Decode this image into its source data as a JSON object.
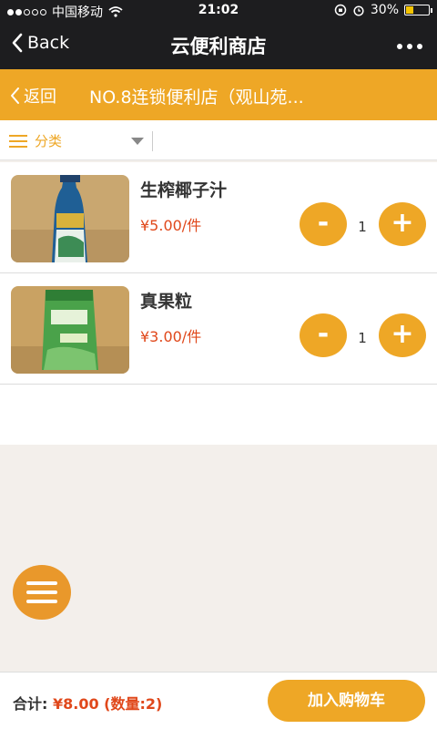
{
  "status_bar": {
    "carrier": "中国移动",
    "time": "21:02",
    "battery": "30%"
  },
  "nav": {
    "back_label": "Back",
    "title": "云便利商店"
  },
  "sub_header": {
    "back_label": "返回",
    "store_name": "NO.8连锁便利店（观山苑..."
  },
  "filter": {
    "category_label": "分类"
  },
  "products": [
    {
      "name": "生榨椰子汁",
      "price": "¥5.00/件",
      "minus": "-",
      "plus": "+",
      "quantity": "1"
    },
    {
      "name": "真果粒",
      "price": "¥3.00/件",
      "minus": "-",
      "plus": "+",
      "quantity": "1"
    }
  ],
  "footer": {
    "total_label": "合计:",
    "total_amount": "¥8.00",
    "count": "(数量:2)",
    "add_to_cart": "加入购物车"
  },
  "colors": {
    "accent": "#eea726",
    "price": "#e0481b",
    "header_bg": "#1d1d1f"
  }
}
